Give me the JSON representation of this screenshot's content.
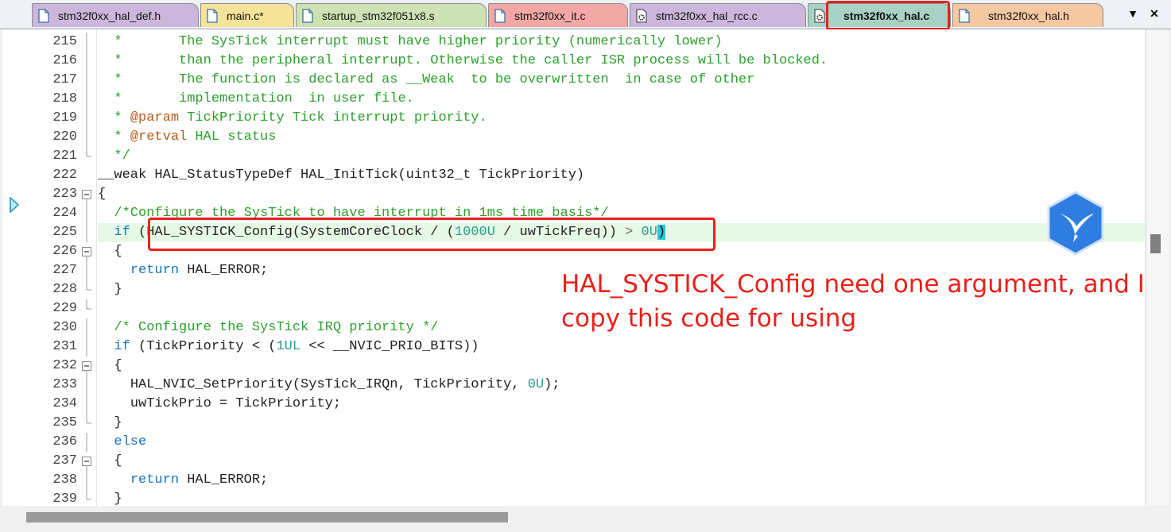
{
  "tabs": [
    {
      "label": "stm32f0xx_hal_def.h",
      "color": "#cdb6dc",
      "icon": "file-icon"
    },
    {
      "label": "main.c*",
      "color": "#f5e39a",
      "icon": "file-icon"
    },
    {
      "label": "startup_stm32f051x8.s",
      "color": "#cde3b4",
      "icon": "file-icon"
    },
    {
      "label": "stm32f0xx_it.c",
      "color": "#f3a7a7",
      "icon": "file-icon"
    },
    {
      "label": "stm32f0xx_hal_rcc.c",
      "color": "#cdb6dc",
      "icon": "settings-file-icon"
    },
    {
      "label": "stm32f0xx_hal.c",
      "color": "#a9d2c6",
      "icon": "settings-file-icon",
      "active": true
    },
    {
      "label": "stm32f0xx_hal.h",
      "color": "#f6c8a2",
      "icon": "file-icon"
    }
  ],
  "tabbar_buttons": {
    "dropdown": "▼",
    "close": "✕"
  },
  "editor": {
    "current_line": "222",
    "highlighted_line": "225"
  },
  "annotation": {
    "text": "HAL_SYSTICK_Config need one argument, and I copy this code for using",
    "color": "#e8211b"
  },
  "lines": [
    {
      "n": "215",
      "fold": "line"
    },
    {
      "n": "216",
      "fold": "line"
    },
    {
      "n": "217",
      "fold": "line"
    },
    {
      "n": "218",
      "fold": "line"
    },
    {
      "n": "219",
      "fold": "line"
    },
    {
      "n": "220",
      "fold": "line"
    },
    {
      "n": "221",
      "fold": "end"
    },
    {
      "n": "222",
      "fold": "none"
    },
    {
      "n": "223",
      "fold": "box"
    },
    {
      "n": "224",
      "fold": "line"
    },
    {
      "n": "225",
      "fold": "line"
    },
    {
      "n": "226",
      "fold": "box"
    },
    {
      "n": "227",
      "fold": "line"
    },
    {
      "n": "228",
      "fold": "end"
    },
    {
      "n": "229",
      "fold": "end"
    },
    {
      "n": "230",
      "fold": "line"
    },
    {
      "n": "231",
      "fold": "line"
    },
    {
      "n": "232",
      "fold": "box"
    },
    {
      "n": "233",
      "fold": "line"
    },
    {
      "n": "234",
      "fold": "line"
    },
    {
      "n": "235",
      "fold": "end"
    },
    {
      "n": "236",
      "fold": "line"
    },
    {
      "n": "237",
      "fold": "box"
    },
    {
      "n": "238",
      "fold": "line"
    },
    {
      "n": "239",
      "fold": "end"
    }
  ],
  "code": {
    "l215": [
      "*       The SysTick interrupt must have higher priority (numerically lower)"
    ],
    "l216": [
      "*       than the peripheral interrupt. Otherwise the caller ISR process will be blocked."
    ],
    "l217": [
      "*       The function is declared as __Weak  to be overwritten  in case of other"
    ],
    "l218": [
      "*       implementation  in user file."
    ],
    "l219": [
      "* ",
      "@param",
      " TickPriority Tick interrupt priority."
    ],
    "l220": [
      "* ",
      "@retval",
      " HAL status"
    ],
    "l221": [
      "*/"
    ],
    "l222": [
      "__weak HAL_StatusTypeDef HAL_InitTick(uint32_t TickPriority)"
    ],
    "l223": [
      "{"
    ],
    "l224": [
      "/*Configure the SysTick to have interrupt in 1ms time basis*/"
    ],
    "l225": [
      "if",
      " ",
      "(",
      "HAL_SYSTICK_Config(SystemCoreClock / (",
      "1000U",
      " / uwTickFreq)) ",
      ">",
      " ",
      "0U",
      ")"
    ],
    "l226": [
      "{"
    ],
    "l227": [
      "return",
      " HAL_ERROR;"
    ],
    "l228": [
      "}"
    ],
    "l229": [
      ""
    ],
    "l230": [
      "/* Configure the SysTick IRQ priority */"
    ],
    "l231": [
      "if",
      " (TickPriority < (",
      "1UL",
      " << __NVIC_PRIO_BITS))"
    ],
    "l232": [
      "{"
    ],
    "l233": [
      "HAL_NVIC_SetPriority(SysTick_IRQn, TickPriority, ",
      "0U",
      ");"
    ],
    "l234": [
      "uwTickPrio = TickPriority;"
    ],
    "l235": [
      "}"
    ],
    "l236": [
      "else"
    ],
    "l237": [
      "{"
    ],
    "l238": [
      "return",
      " HAL_ERROR;"
    ],
    "l239": [
      "}"
    ]
  },
  "logo": {
    "icon": "bird-logo-icon",
    "color": "#2f7de1"
  }
}
